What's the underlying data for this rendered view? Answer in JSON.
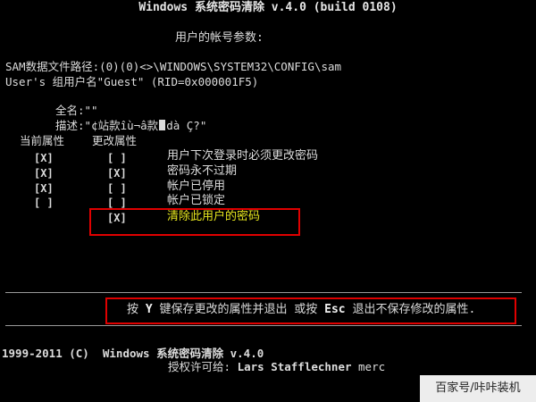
{
  "app": {
    "title": "Windows 系统密码清除 v.4.0 (build 0108)",
    "subtitle": "用户的帐号参数:"
  },
  "account": {
    "sam_path": "SAM数据文件路径:(0)(0)<>\\WINDOWS\\SYSTEM32\\CONFIG\\sam",
    "user_line": "User's 组用户名\"Guest\" (RID=0x000001F5)",
    "fullname_line": "全名:\"\"",
    "desc_prefix": "描述:\"¢站款îù¬â款",
    "desc_suffix": "dà Ç?\""
  },
  "attributes": {
    "header_current": "当前属性",
    "header_change": "更改属性",
    "rows": [
      {
        "current": "[X]",
        "change": "[ ]",
        "label": "用户下次登录时必须更改密码"
      },
      {
        "current": "[X]",
        "change": "[X]",
        "label": "密码永不过期"
      },
      {
        "current": "[X]",
        "change": "[ ]",
        "label": "帐户已停用"
      },
      {
        "current": "[ ]",
        "change": "[ ]",
        "label": "帐户已锁定"
      },
      {
        "current": "",
        "change": "[X]",
        "label": "清除此用户的密码"
      }
    ]
  },
  "hint": {
    "pre": "按 ",
    "key_save": "Y",
    "mid": " 键保存更改的属性并退出 或按 ",
    "key_esc": "Esc",
    "post": " 退出不保存修改的属性."
  },
  "footer": {
    "copyright": "1999-2011 (C)  Windows 系统密码清除 v.4.0",
    "license_label": "授权许可给: ",
    "licensee": "Lars Stafflechner",
    "licensee_tail": " merc"
  },
  "watermark": {
    "text": "百家号/咔咔装机"
  },
  "colors": {
    "background": "#000000",
    "text": "#dcdcdc",
    "highlight_text": "#e6e61e",
    "annotation_box": "#e00000"
  }
}
